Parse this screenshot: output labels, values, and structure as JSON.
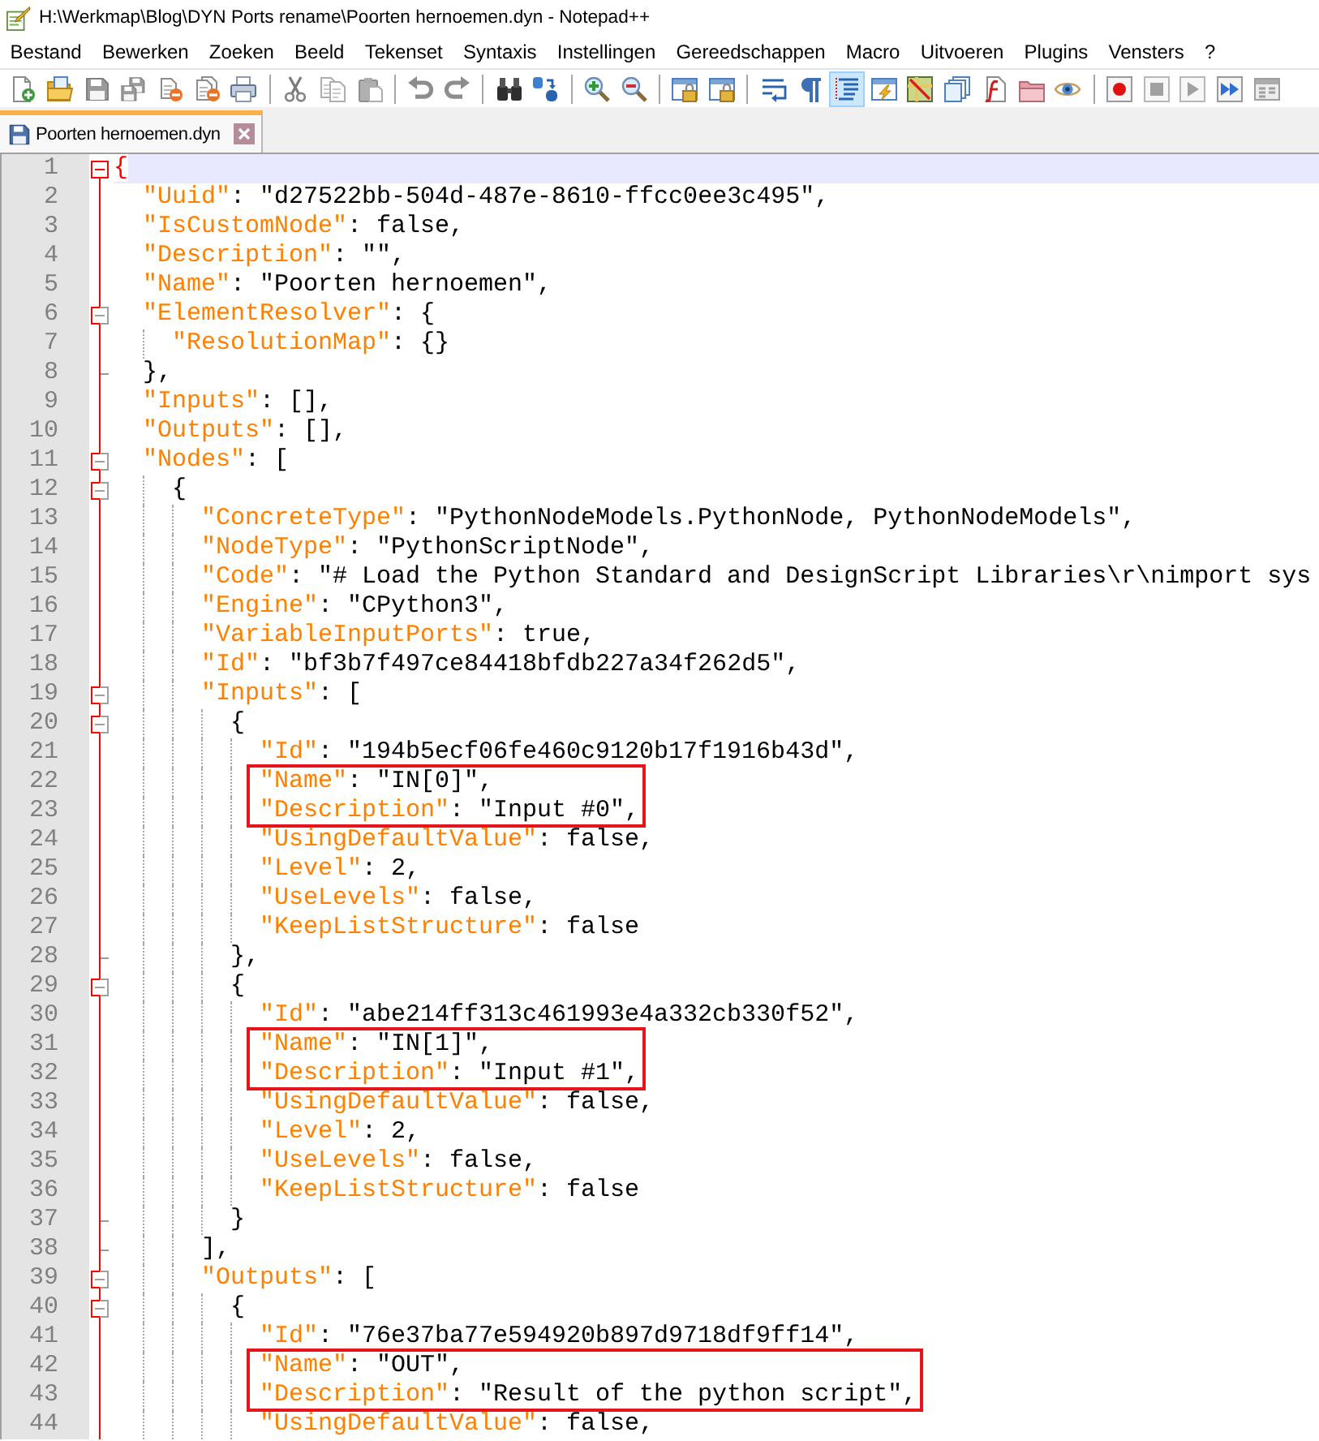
{
  "window": {
    "title": "H:\\Werkmap\\Blog\\DYN Ports rename\\Poorten hernoemen.dyn - Notepad++"
  },
  "menu": [
    "Bestand",
    "Bewerken",
    "Zoeken",
    "Beeld",
    "Tekenset",
    "Syntaxis",
    "Instellingen",
    "Gereedschappen",
    "Macro",
    "Uitvoeren",
    "Plugins",
    "Vensters",
    "?"
  ],
  "toolbar": {
    "groups": [
      [
        {
          "disabled": false,
          "pressed": false
        },
        {
          "disabled": false,
          "pressed": false
        },
        {
          "disabled": true,
          "pressed": false
        },
        {
          "disabled": true,
          "pressed": false
        },
        {
          "disabled": false,
          "pressed": false
        },
        {
          "disabled": false,
          "pressed": false
        },
        {
          "disabled": false,
          "pressed": false
        }
      ],
      [
        {
          "disabled": true,
          "pressed": false
        },
        {
          "disabled": true,
          "pressed": false
        },
        {
          "disabled": true,
          "pressed": false
        }
      ],
      [
        {
          "disabled": true,
          "pressed": false
        },
        {
          "disabled": true,
          "pressed": false
        }
      ],
      [
        {
          "disabled": false,
          "pressed": false
        },
        {
          "disabled": false,
          "pressed": false
        }
      ],
      [
        {
          "disabled": false,
          "pressed": false
        },
        {
          "disabled": false,
          "pressed": false
        }
      ],
      [
        {
          "disabled": false,
          "pressed": false
        },
        {
          "disabled": false,
          "pressed": false
        }
      ],
      [
        {
          "disabled": false,
          "pressed": false
        },
        {
          "disabled": false,
          "pressed": false
        },
        {
          "disabled": false,
          "pressed": true
        },
        {
          "disabled": false,
          "pressed": false
        },
        {
          "disabled": false,
          "pressed": false
        },
        {
          "disabled": false,
          "pressed": false
        },
        {
          "disabled": false,
          "pressed": false
        },
        {
          "disabled": false,
          "pressed": false
        },
        {
          "disabled": false,
          "pressed": false
        }
      ],
      [
        {
          "disabled": false,
          "pressed": false
        },
        {
          "disabled": true,
          "pressed": false
        },
        {
          "disabled": true,
          "pressed": false
        },
        {
          "disabled": false,
          "pressed": false
        },
        {
          "disabled": true,
          "pressed": false
        }
      ]
    ]
  },
  "tabs": [
    {
      "label": "Poorten hernoemen.dyn",
      "selected": true
    }
  ],
  "editor": {
    "lines": [
      {
        "kind": "line",
        "number": "1",
        "text": "{",
        "current": true,
        "brace_match": true,
        "expanded": true,
        "children": [
          {
            "kind": "line",
            "number": "2",
            "key": "\"Uuid\"",
            "text": ": \"d27522bb-504d-487e-8610-ffcc0ee3c495\",",
            "current": false,
            "brace_match": false
          },
          {
            "kind": "line",
            "number": "3",
            "key": "\"IsCustomNode\"",
            "text": ": false,",
            "current": false,
            "brace_match": false
          },
          {
            "kind": "line",
            "number": "4",
            "key": "\"Description\"",
            "text": ": \"\",",
            "current": false,
            "brace_match": false
          },
          {
            "kind": "line",
            "number": "5",
            "key": "\"Name\"",
            "text": ": \"Poorten hernoemen\",",
            "current": false,
            "brace_match": false
          },
          {
            "kind": "line",
            "number": "6",
            "key": "\"ElementResolver\"",
            "text": ": {",
            "current": false,
            "brace_match": false,
            "expanded": true,
            "children": [
              {
                "kind": "line",
                "number": "7",
                "key": "\"ResolutionMap\"",
                "text": ": {}",
                "current": false,
                "brace_match": false
              },
              {
                "kind": "close",
                "number": "8",
                "text": "},",
                "current": false,
                "brace_match": false
              }
            ]
          },
          {
            "kind": "line",
            "number": "9",
            "key": "\"Inputs\"",
            "text": ": [],",
            "current": false,
            "brace_match": false
          },
          {
            "kind": "line",
            "number": "10",
            "key": "\"Outputs\"",
            "text": ": [],",
            "current": false,
            "brace_match": false
          },
          {
            "kind": "line",
            "number": "11",
            "key": "\"Nodes\"",
            "text": ": [",
            "current": false,
            "brace_match": false,
            "expanded": true,
            "children": [
              {
                "kind": "line",
                "number": "12",
                "text": "{",
                "current": false,
                "brace_match": false,
                "expanded": true,
                "children": [
                  {
                    "kind": "line",
                    "number": "13",
                    "key": "\"ConcreteType\"",
                    "text": ": \"PythonNodeModels.PythonNode, PythonNodeModels\",",
                    "current": false,
                    "brace_match": false
                  },
                  {
                    "kind": "line",
                    "number": "14",
                    "key": "\"NodeType\"",
                    "text": ": \"PythonScriptNode\",",
                    "current": false,
                    "brace_match": false
                  },
                  {
                    "kind": "line",
                    "number": "15",
                    "key": "\"Code\"",
                    "text": ": \"# Load the Python Standard and DesignScript Libraries\\r\\nimport sys",
                    "current": false,
                    "brace_match": false
                  },
                  {
                    "kind": "line",
                    "number": "16",
                    "key": "\"Engine\"",
                    "text": ": \"CPython3\",",
                    "current": false,
                    "brace_match": false
                  },
                  {
                    "kind": "line",
                    "number": "17",
                    "key": "\"VariableInputPorts\"",
                    "text": ": true,",
                    "current": false,
                    "brace_match": false
                  },
                  {
                    "kind": "line",
                    "number": "18",
                    "key": "\"Id\"",
                    "text": ": \"bf3b7f497ce84418bfdb227a34f262d5\",",
                    "current": false,
                    "brace_match": false
                  },
                  {
                    "kind": "line",
                    "number": "19",
                    "key": "\"Inputs\"",
                    "text": ": [",
                    "current": false,
                    "brace_match": false,
                    "expanded": true,
                    "children": [
                      {
                        "kind": "line",
                        "number": "20",
                        "text": "{",
                        "current": false,
                        "brace_match": false,
                        "expanded": true,
                        "children": [
                          {
                            "kind": "line",
                            "number": "21",
                            "key": "\"Id\"",
                            "text": ": \"194b5ecf06fe460c9120b17f1916b43d\",",
                            "current": false,
                            "brace_match": false
                          },
                          {
                            "kind": "boxed",
                            "lines": [
                              {
                                "kind": "line",
                                "number": "22",
                                "key": "\"Name\"",
                                "text": ": \"IN[0]\",",
                                "current": false,
                                "brace_match": false
                              },
                              {
                                "kind": "line",
                                "number": "23",
                                "key": "\"Description\"",
                                "text": ": \"Input #0\",",
                                "current": false,
                                "brace_match": false
                              }
                            ]
                          },
                          {
                            "kind": "line",
                            "number": "24",
                            "key": "\"UsingDefaultValue\"",
                            "text": ": false,",
                            "current": false,
                            "brace_match": false
                          },
                          {
                            "kind": "line",
                            "number": "25",
                            "key": "\"Level\"",
                            "text": ": 2,",
                            "current": false,
                            "brace_match": false
                          },
                          {
                            "kind": "line",
                            "number": "26",
                            "key": "\"UseLevels\"",
                            "text": ": false,",
                            "current": false,
                            "brace_match": false
                          },
                          {
                            "kind": "line",
                            "number": "27",
                            "key": "\"KeepListStructure\"",
                            "text": ": false",
                            "current": false,
                            "brace_match": false
                          },
                          {
                            "kind": "close",
                            "number": "28",
                            "text": "},",
                            "current": false,
                            "brace_match": false
                          }
                        ]
                      },
                      {
                        "kind": "line",
                        "number": "29",
                        "text": "{",
                        "current": false,
                        "brace_match": false,
                        "expanded": true,
                        "children": [
                          {
                            "kind": "line",
                            "number": "30",
                            "key": "\"Id\"",
                            "text": ": \"abe214ff313c461993e4a332cb330f52\",",
                            "current": false,
                            "brace_match": false
                          },
                          {
                            "kind": "boxed",
                            "lines": [
                              {
                                "kind": "line",
                                "number": "31",
                                "key": "\"Name\"",
                                "text": ": \"IN[1]\",",
                                "current": false,
                                "brace_match": false
                              },
                              {
                                "kind": "line",
                                "number": "32",
                                "key": "\"Description\"",
                                "text": ": \"Input #1\",",
                                "current": false,
                                "brace_match": false
                              }
                            ]
                          },
                          {
                            "kind": "line",
                            "number": "33",
                            "key": "\"UsingDefaultValue\"",
                            "text": ": false,",
                            "current": false,
                            "brace_match": false
                          },
                          {
                            "kind": "line",
                            "number": "34",
                            "key": "\"Level\"",
                            "text": ": 2,",
                            "current": false,
                            "brace_match": false
                          },
                          {
                            "kind": "line",
                            "number": "35",
                            "key": "\"UseLevels\"",
                            "text": ": false,",
                            "current": false,
                            "brace_match": false
                          },
                          {
                            "kind": "line",
                            "number": "36",
                            "key": "\"KeepListStructure\"",
                            "text": ": false",
                            "current": false,
                            "brace_match": false
                          },
                          {
                            "kind": "close",
                            "number": "37",
                            "text": "}",
                            "current": false,
                            "brace_match": false
                          }
                        ]
                      },
                      {
                        "kind": "close",
                        "number": "38",
                        "text": "],",
                        "current": false,
                        "brace_match": false
                      }
                    ]
                  },
                  {
                    "kind": "line",
                    "number": "39",
                    "key": "\"Outputs\"",
                    "text": ": [",
                    "current": false,
                    "brace_match": false,
                    "expanded": true,
                    "children": [
                      {
                        "kind": "line",
                        "number": "40",
                        "text": "{",
                        "current": false,
                        "brace_match": false,
                        "expanded": true,
                        "children": [
                          {
                            "kind": "line",
                            "number": "41",
                            "key": "\"Id\"",
                            "text": ": \"76e37ba77e594920b897d9718df9ff14\",",
                            "current": false,
                            "brace_match": false
                          },
                          {
                            "kind": "boxed",
                            "lines": [
                              {
                                "kind": "line",
                                "number": "42",
                                "key": "\"Name\"",
                                "text": ": \"OUT\",",
                                "current": false,
                                "brace_match": false
                              },
                              {
                                "kind": "line",
                                "number": "43",
                                "key": "\"Description\"",
                                "text": ": \"Result of the python script\",",
                                "current": false,
                                "brace_match": false
                              }
                            ]
                          },
                          {
                            "kind": "line",
                            "number": "44",
                            "key": "\"UsingDefaultValue\"",
                            "text": ": false,",
                            "current": false,
                            "brace_match": false
                          }
                        ]
                      }
                    ]
                  }
                ]
              }
            ]
          }
        ]
      }
    ]
  }
}
